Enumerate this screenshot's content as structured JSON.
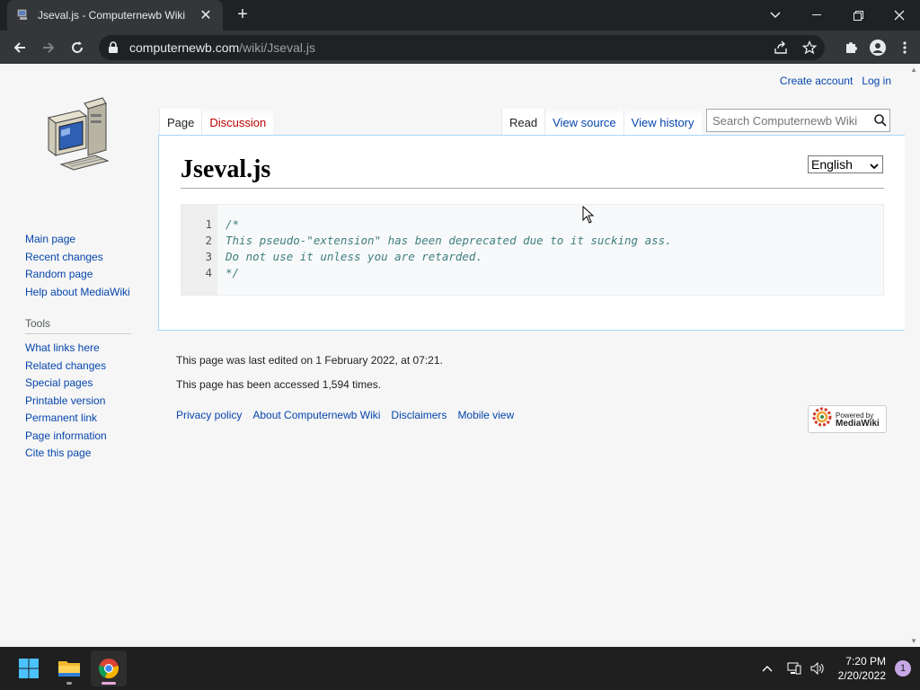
{
  "browser": {
    "tab_title": "Jseval.js - Computernewb Wiki",
    "url_host": "computernewb.com",
    "url_path": "/wiki/Jseval.js"
  },
  "wiki": {
    "personal": {
      "create_account": "Create account",
      "log_in": "Log in"
    },
    "tabs": {
      "page": "Page",
      "discussion": "Discussion",
      "read": "Read",
      "view_source": "View source",
      "view_history": "View history"
    },
    "search_placeholder": "Search Computernewb Wiki",
    "title": "Jseval.js",
    "language": "English",
    "code_lines": [
      {
        "n": "1",
        "text": "/*"
      },
      {
        "n": "2",
        "text": "This pseudo-\"extension\" has been deprecated due to it sucking ass."
      },
      {
        "n": "3",
        "text": "Do not use it unless you are retarded."
      },
      {
        "n": "4",
        "text": "*/"
      }
    ],
    "navigation": [
      "Main page",
      "Recent changes",
      "Random page",
      "Help about MediaWiki"
    ],
    "tools_heading": "Tools",
    "tools": [
      "What links here",
      "Related changes",
      "Special pages",
      "Printable version",
      "Permanent link",
      "Page information",
      "Cite this page"
    ],
    "footer": {
      "last_edited": "This page was last edited on 1 February 2022, at 07:21.",
      "accessed": "This page has been accessed 1,594 times.",
      "links": [
        "Privacy policy",
        "About Computernewb Wiki",
        "Disclaimers",
        "Mobile view"
      ],
      "powered_by_top": "Powered by",
      "powered_by_bottom": "MediaWiki"
    }
  },
  "taskbar": {
    "time": "7:20 PM",
    "date": "2/20/2022",
    "notification_count": "1"
  },
  "colors": {
    "link": "#0645ad",
    "new_link": "#ba0000",
    "chrome_dark": "#202124",
    "chrome_toolbar": "#35363a"
  }
}
